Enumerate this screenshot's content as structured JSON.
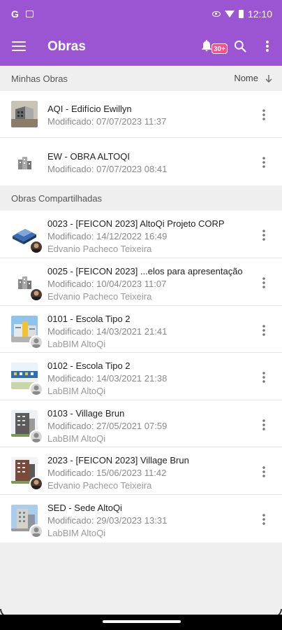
{
  "status_bar": {
    "time": "12:10",
    "icons": [
      "g-icon",
      "message-icon",
      "eye-icon",
      "wifi-icon",
      "battery-icon"
    ]
  },
  "app_bar": {
    "title": "Obras",
    "notification_badge": "30+",
    "icons": [
      "menu-icon",
      "bell-icon",
      "search-icon",
      "more-vertical-icon"
    ]
  },
  "my_works": {
    "header": "Minhas Obras",
    "sort_label": "Nome",
    "items": [
      {
        "title": "AQI - Edifício Ewillyn",
        "modified": "Modificado: 07/07/2023 11:37",
        "thumb": "building-photo"
      },
      {
        "title": "EW - OBRA ALTOQI",
        "modified": "Modificado: 07/07/2023 08:41",
        "thumb": "building-icon"
      }
    ]
  },
  "shared_works": {
    "header": "Obras Compartilhadas",
    "items": [
      {
        "title": "0023 - [FEICON 2023]  AltoQi Projeto CORP",
        "modified": "Modificado: 14/12/2022 16:49",
        "owner": "Edvanio Pacheco Teixeira"
      },
      {
        "title": "0025 - [FEICON 2023] ...elos para apresentação",
        "modified": "Modificado: 10/04/2023 11:07",
        "owner": "Edvanio Pacheco Teixeira"
      },
      {
        "title": "0101 - Escola Tipo 2",
        "modified": "Modificado: 14/03/2021 21:41",
        "owner": "LabBIM AltoQi"
      },
      {
        "title": "0102 - Escola Tipo 2",
        "modified": "Modificado: 14/03/2021 21:38",
        "owner": "LabBIM AltoQi"
      },
      {
        "title": "0103 - Village Brun",
        "modified": "Modificado: 27/05/2021 07:59",
        "owner": "LabBIM AltoQi"
      },
      {
        "title": "2023 - [FEICON 2023] Village Brun",
        "modified": "Modificado: 15/06/2023 11:42",
        "owner": "Edvanio Pacheco Teixeira"
      },
      {
        "title": "SED - Sede AltoQi",
        "modified": "Modificado: 29/03/2023 13:31",
        "owner": "LabBIM AltoQi"
      }
    ]
  },
  "colors": {
    "primary": "#9b55d3",
    "badge": "#ff4b8b",
    "background": "#efefef"
  }
}
